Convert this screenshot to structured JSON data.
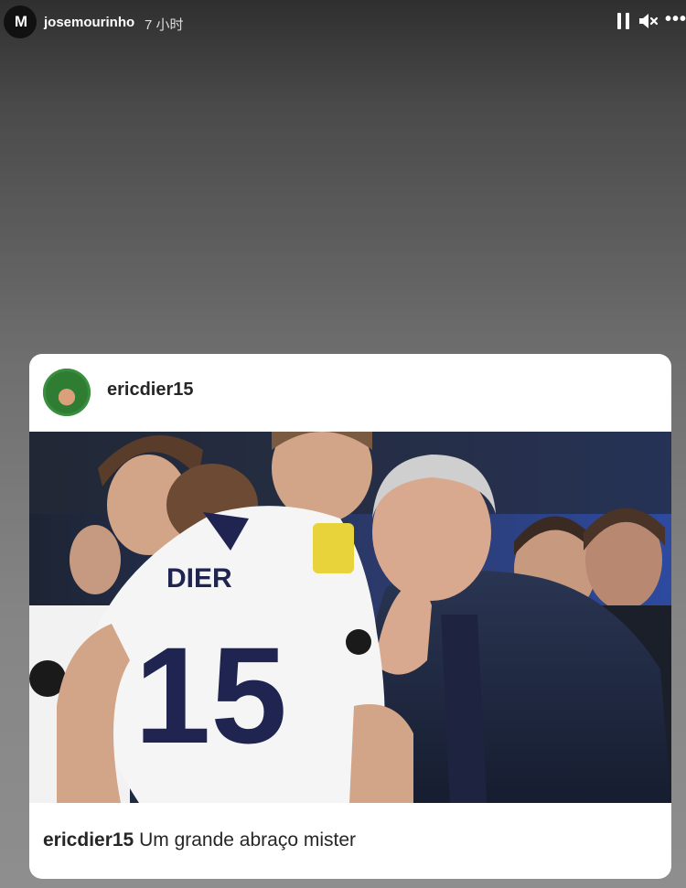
{
  "story": {
    "username": "josemourinho",
    "time": "7 小时",
    "avatar_text": "M"
  },
  "controls": {
    "pause_icon": "pause-icon",
    "mute_icon": "mute-icon",
    "more_icon": "more-icon",
    "more_glyph": "•••"
  },
  "shared_post": {
    "username": "ericdier15",
    "jersey_name": "DIER",
    "jersey_number": "15",
    "caption_user": "ericdier15",
    "caption_text": " Um grande abraço mister"
  }
}
